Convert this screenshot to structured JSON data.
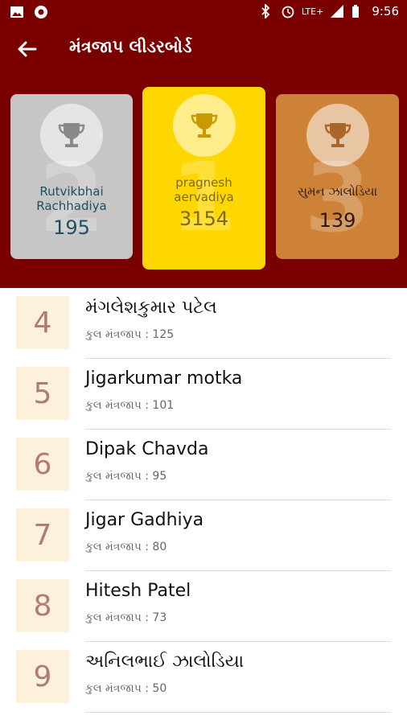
{
  "status": {
    "time": "9:56",
    "network": "LTE+"
  },
  "toolbar": {
    "title": "મંત્રજાપ લીડરબોર્ડ"
  },
  "podium": [
    {
      "rank": "2",
      "name": "Rutvikbhai Rachhadiya",
      "score": "195",
      "color": "#c6c6c6"
    },
    {
      "rank": "1",
      "name": "pragnesh aervadiya",
      "score": "3154",
      "color": "#ffd700"
    },
    {
      "rank": "3",
      "name": "સુમન ઝાલોડિયા",
      "score": "139",
      "color": "#cd8237"
    }
  ],
  "list": [
    {
      "rank": "4",
      "name": "મંગલેશકુમાર પટેલ",
      "sub": "કુલ મંત્રજાપ : 125"
    },
    {
      "rank": "5",
      "name": "Jigarkumar motka",
      "sub": "કુલ મંત્રજાપ : 101"
    },
    {
      "rank": "6",
      "name": "Dipak Chavda",
      "sub": "કુલ મંત્રજાપ : 95"
    },
    {
      "rank": "7",
      "name": "Jigar Gadhiya",
      "sub": "કુલ મંત્રજાપ : 80"
    },
    {
      "rank": "8",
      "name": "Hitesh Patel",
      "sub": "કુલ મંત્રજાપ : 73"
    },
    {
      "rank": "9",
      "name": "અનિલભાઈ ઝાલોડિયા",
      "sub": "કુલ મંત્રજાપ : 50"
    }
  ],
  "colors": {
    "primary": "#7a0000",
    "rank_bg": "#fdf1dc",
    "rank_fg": "#b07a7a"
  }
}
